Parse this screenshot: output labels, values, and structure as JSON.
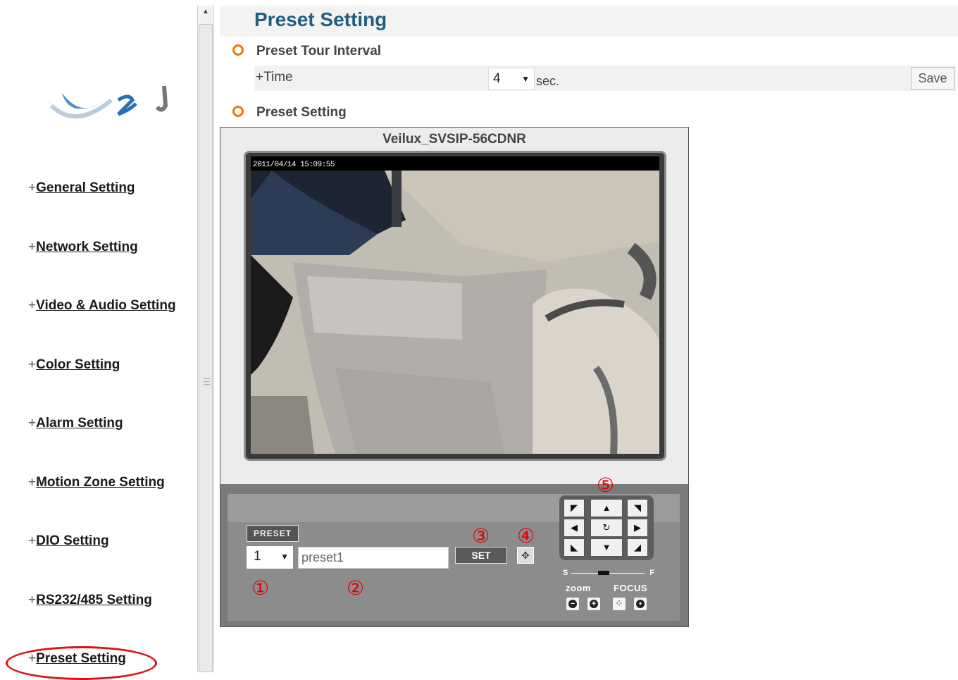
{
  "page": {
    "title": "Preset Setting"
  },
  "sidebar": {
    "items": [
      {
        "prefix": "+",
        "label": "General Setting"
      },
      {
        "prefix": "+",
        "label": "Network Setting"
      },
      {
        "prefix": "+",
        "label": "Video & Audio Setting"
      },
      {
        "prefix": "+",
        "label": "Color Setting"
      },
      {
        "prefix": "+",
        "label": "Alarm Setting"
      },
      {
        "prefix": "+",
        "label": "Motion Zone Setting"
      },
      {
        "prefix": "+",
        "label": "DIO Setting"
      },
      {
        "prefix": "+",
        "label": "RS232/485 Setting"
      },
      {
        "prefix": "+",
        "label": "Preset Setting"
      }
    ],
    "highlighted_item": "Preset Setting",
    "highlight_color": "#e01010"
  },
  "tour": {
    "heading": "Preset Tour Interval",
    "time_label": "+Time",
    "time_value": "4",
    "unit": "sec.",
    "save_label": "Save"
  },
  "preset": {
    "heading": "Preset Setting",
    "camera_name": "Veilux_SVSIP-56CDNR",
    "timestamp": "2011/04/14 15:09:55",
    "preset_tag": "PRESET",
    "preset_number": "1",
    "preset_name": "preset1",
    "set_label": "SET",
    "move_icon": "move-icon",
    "markers": [
      "①",
      "②",
      "③",
      "④",
      "⑤"
    ]
  },
  "ptz": {
    "arrows": [
      "◤",
      "▲",
      "◥",
      "◀",
      "↻",
      "▶",
      "◣",
      "▼",
      "◢"
    ],
    "slow_label": "S",
    "fast_label": "F",
    "zoom_label": "zoom",
    "focus_label": "FOCUS"
  },
  "colors": {
    "title_color": "#1f5f80",
    "bullet_color": "#f07800",
    "marker_color": "#e00000"
  }
}
